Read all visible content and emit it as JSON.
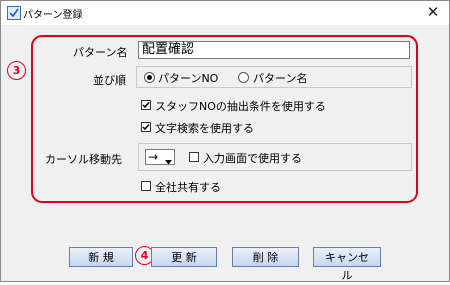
{
  "window": {
    "title": "パターン登録",
    "close_glyph": "✕"
  },
  "markers": {
    "section": "3",
    "update": "4"
  },
  "form": {
    "pattern_name_label": "パターン名",
    "pattern_name_value": "配置確認",
    "sort_label": "並び順",
    "sort_options": [
      "パターンNO",
      "パターン名"
    ],
    "sort_selected": "パターンNO",
    "staff_no_checkbox": "スタッフNOの抽出条件を使用する",
    "staff_no_checked": true,
    "text_search_checkbox": "文字検索を使用する",
    "text_search_checked": true,
    "cursor_move_label": "カーソル移動先",
    "cursor_move_value": "→",
    "input_screen_checkbox": "入力画面で使用する",
    "input_screen_checked": false,
    "share_all_checkbox": "全社共有する",
    "share_all_checked": false
  },
  "buttons": {
    "new": "新 規",
    "update": "更 新",
    "delete": "削 除",
    "cancel": "キャンセル"
  },
  "colors": {
    "highlight": "#e2001a",
    "button_border": "#6b7fa6"
  }
}
